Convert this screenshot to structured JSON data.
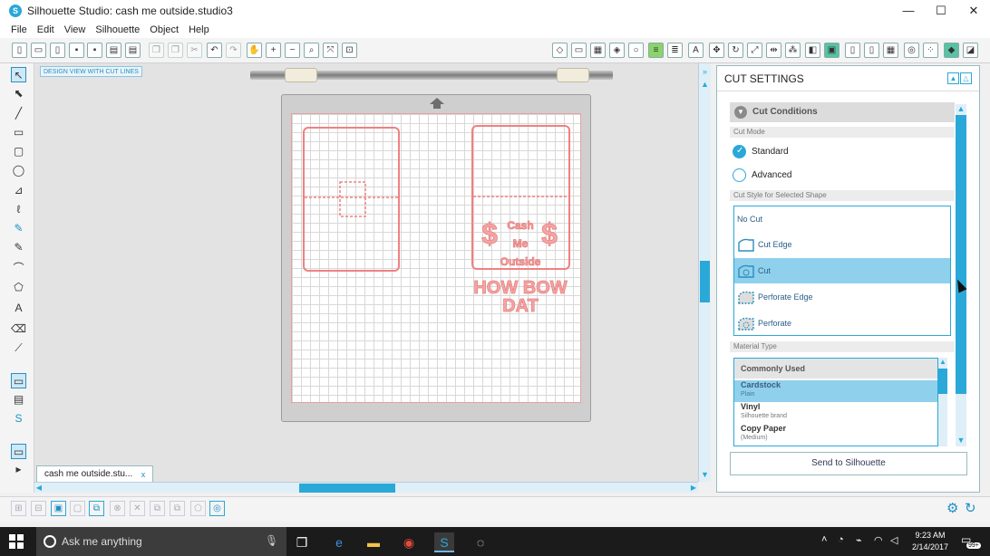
{
  "window": {
    "title": "Silhouette Studio: cash me outside.studio3",
    "min_glyph": "—",
    "max_glyph": "☐",
    "close_glyph": "✕"
  },
  "menu": [
    "File",
    "Edit",
    "View",
    "Silhouette",
    "Object",
    "Help"
  ],
  "canvas": {
    "view_label": "DESIGN VIEW WITH CUT LINES",
    "tab_label": "cash me outside.stu...",
    "tab_close": "x",
    "design_text": [
      "$",
      "Cash",
      "Me",
      "Outside",
      "$",
      "HOW BOW",
      "DAT"
    ]
  },
  "cut_settings": {
    "title": "CUT SETTINGS",
    "section": "Cut Conditions",
    "cut_mode_label": "Cut Mode",
    "modes": [
      {
        "label": "Standard",
        "checked": true
      },
      {
        "label": "Advanced",
        "checked": false
      }
    ],
    "cut_style_label": "Cut Style for Selected Shape",
    "styles": [
      {
        "label": "No Cut",
        "selected": false
      },
      {
        "label": "Cut Edge",
        "selected": false
      },
      {
        "label": "Cut",
        "selected": true
      },
      {
        "label": "Perforate Edge",
        "selected": false
      },
      {
        "label": "Perforate",
        "selected": false
      }
    ],
    "material_type_label": "Material Type",
    "material_group": "Commonly Used",
    "materials": [
      {
        "name": "Cardstock",
        "desc": "Plain",
        "selected": true
      },
      {
        "name": "Vinyl",
        "desc": "Silhouette brand",
        "selected": false
      },
      {
        "name": "Copy Paper",
        "desc": "(Medium)",
        "selected": false
      }
    ],
    "send_button": "Send to Silhouette"
  },
  "taskbar": {
    "search_placeholder": "Ask me anything",
    "time": "9:23 AM",
    "date": "2/14/2017",
    "notification_count": "99+"
  },
  "colors": {
    "accent": "#2aa8d8",
    "selected_row": "#8fd0ec",
    "cut_line": "#f08080"
  }
}
